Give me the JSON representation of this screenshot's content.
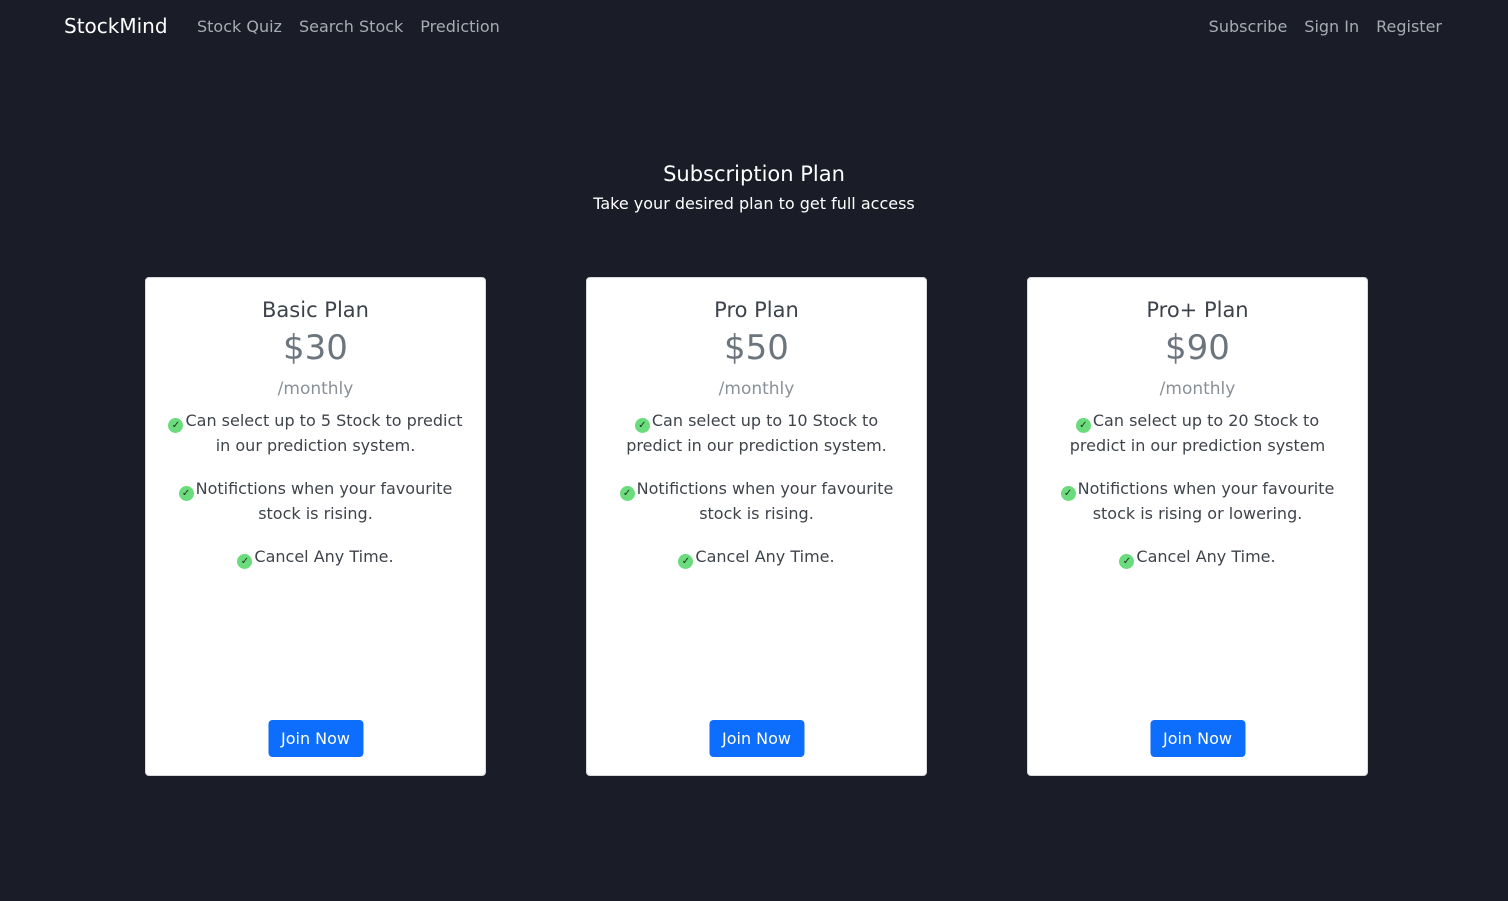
{
  "navbar": {
    "brand": "StockMind",
    "left_links": [
      "Stock Quiz",
      "Search Stock",
      "Prediction"
    ],
    "right_links": [
      "Subscribe",
      "Sign In",
      "Register"
    ]
  },
  "hero": {
    "title": "Subscription Plan",
    "subtitle": "Take your desired plan to get full access"
  },
  "plans": [
    {
      "name": "Basic Plan",
      "price": "$30",
      "period": "/monthly",
      "features": [
        "Can select up to 5 Stock to predict in our prediction system.",
        "Notifictions when your favourite stock is rising.",
        "Cancel Any Time."
      ],
      "button": "Join Now"
    },
    {
      "name": "Pro Plan",
      "price": "$50",
      "period": "/monthly",
      "features": [
        "Can select up to 10 Stock to predict in our prediction system.",
        "Notifictions when your favourite stock is rising.",
        "Cancel Any Time."
      ],
      "button": "Join Now"
    },
    {
      "name": "Pro+ Plan",
      "price": "$90",
      "period": "/monthly",
      "features": [
        "Can select up to 20 Stock to predict in our prediction system",
        "Notifictions when your favourite stock is rising or lowering.",
        "Cancel Any Time."
      ],
      "button": "Join Now"
    }
  ],
  "icons": {
    "feature": "check-circle-icon"
  },
  "colors": {
    "background": "#1a1d28",
    "primary_button": "#0d6efd",
    "check": "#6bdc7c",
    "nav_link": "#a7abb2"
  }
}
